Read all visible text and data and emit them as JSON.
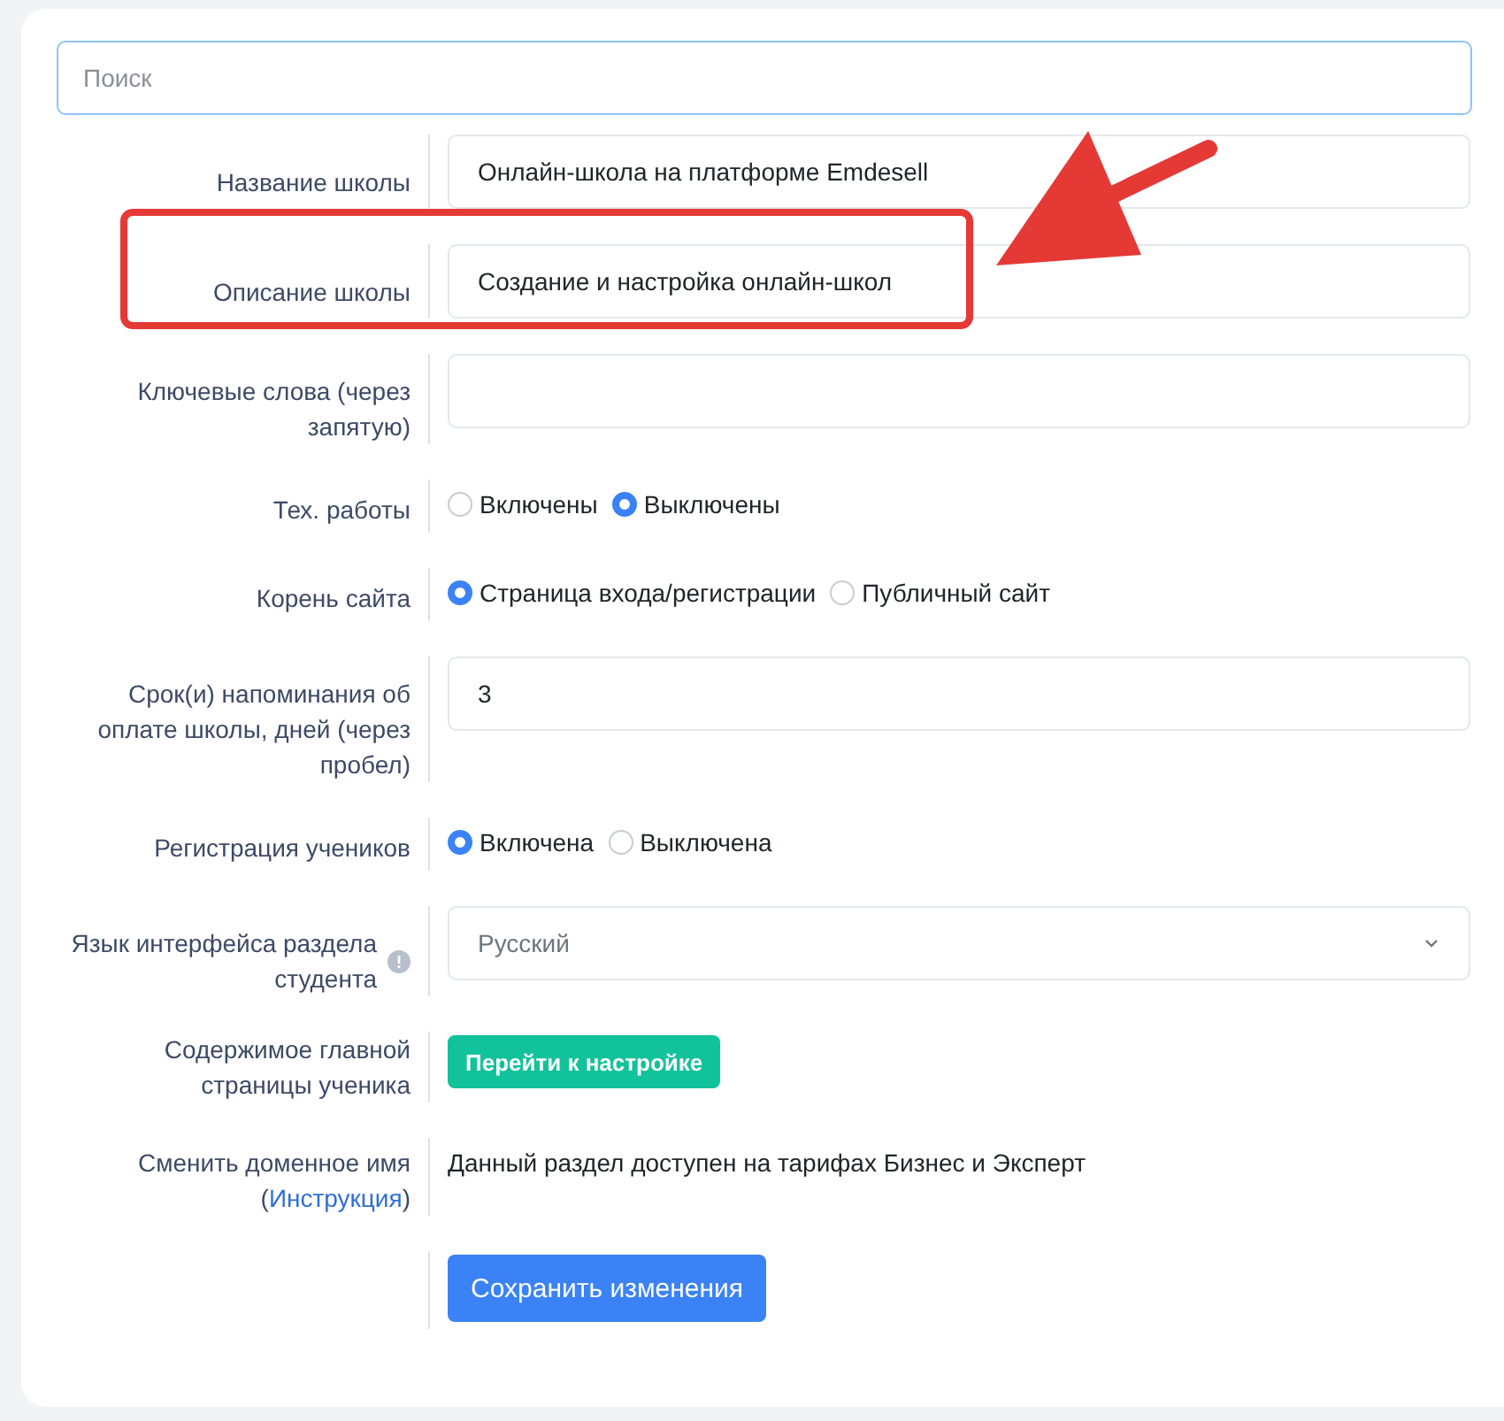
{
  "search": {
    "placeholder": "Поиск"
  },
  "rows": [
    {
      "kind": "text",
      "label": "Название школы",
      "value": "Онлайн-школа на платформе Emdesell",
      "highlighted": false
    },
    {
      "kind": "text",
      "label": "Описание школы",
      "value": "Создание и настройка онлайн-школ",
      "highlighted": true
    },
    {
      "kind": "text",
      "label": "Ключевые слова (через запятую)",
      "value": "",
      "highlighted": false
    },
    {
      "kind": "radio",
      "label": "Тех. работы",
      "options": [
        {
          "label": "Включены",
          "selected": false
        },
        {
          "label": "Выключены",
          "selected": true
        }
      ],
      "highlighted": false
    },
    {
      "kind": "radio",
      "label": "Корень сайта",
      "options": [
        {
          "label": "Страница входа/регистрации",
          "selected": true
        },
        {
          "label": "Публичный сайт",
          "selected": false
        }
      ],
      "highlighted": false
    },
    {
      "kind": "text",
      "label": "Срок(и) напоминания об оплате школы, дней (через пробел)",
      "value": "3",
      "highlighted": false
    },
    {
      "kind": "radio",
      "label": "Регистрация учеников",
      "options": [
        {
          "label": "Включена",
          "selected": true
        },
        {
          "label": "Выключена",
          "selected": false
        }
      ],
      "highlighted": false
    },
    {
      "kind": "select",
      "label": "Язык интерфейса раздела студента",
      "info": true,
      "value": "Русский",
      "highlighted": false
    },
    {
      "kind": "button",
      "label": "Содержимое главной страницы ученика",
      "button": "Перейти к настройке",
      "highlighted": false
    },
    {
      "kind": "note",
      "label_before": "Сменить доменное имя (",
      "link": "Инструкция",
      "label_after": ")",
      "note": "Данный раздел доступен на тарифах Бизнес и Эксперт",
      "highlighted": false
    },
    {
      "kind": "submit",
      "button": "Сохранить изменения",
      "highlighted": false
    }
  ]
}
